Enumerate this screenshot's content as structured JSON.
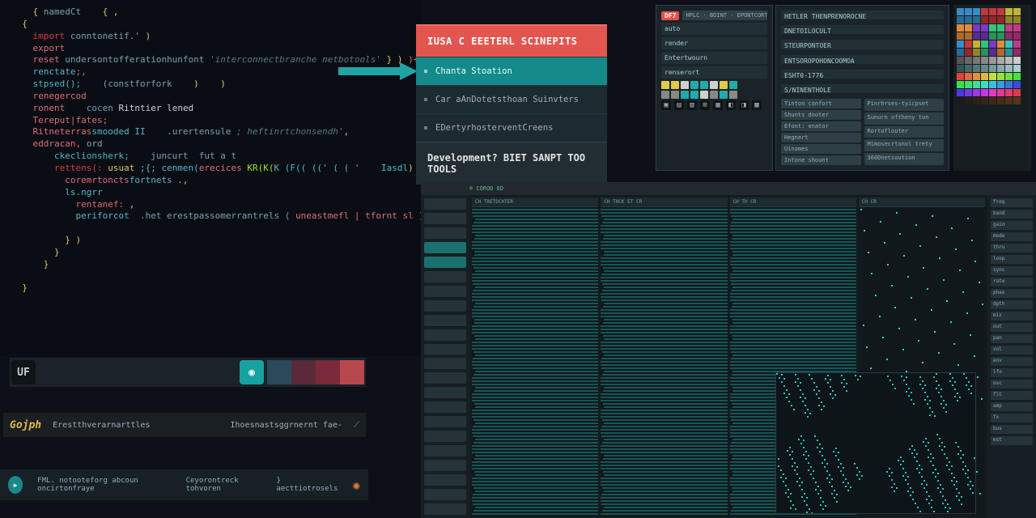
{
  "code": {
    "lines": [
      [
        {
          "c": "tok-punc",
          "t": "    { "
        },
        {
          "c": "tok-var",
          "t": "namedCt"
        },
        {
          "c": "tok-punc",
          "t": "    { ,"
        }
      ],
      [
        {
          "c": "tok-punc",
          "t": "  {"
        }
      ],
      [
        {
          "c": "tok-kw",
          "t": "    import "
        },
        {
          "c": "tok-var",
          "t": "conntonetif.'"
        },
        {
          "c": "tok-punc",
          "t": " )"
        }
      ],
      [
        {
          "c": "tok-type",
          "t": "    export"
        }
      ],
      [
        {
          "c": "tok-type",
          "t": "    reset "
        },
        {
          "c": "tok-var",
          "t": "undersontofferationhunfont"
        },
        {
          "c": "tok-comment",
          "t": " 'interconnectbranche netbotools' "
        },
        {
          "c": "tok-punc",
          "t": "} )"
        },
        {
          "c": "tok-type",
          "t": " )+"
        }
      ],
      [
        {
          "c": "tok-fn",
          "t": "    renctate"
        },
        {
          "c": "tok-type",
          "t": ";,"
        }
      ],
      [
        {
          "c": "tok-prop",
          "t": "    stpsed();"
        },
        {
          "c": "tok-var",
          "t": "    (constforfork"
        },
        {
          "c": "tok-punc",
          "t": "    )    )"
        }
      ],
      [
        {
          "c": "tok-type",
          "t": "    renegercod"
        }
      ],
      [
        {
          "c": "tok-type",
          "t": "    ronent"
        },
        {
          "c": "tok-var",
          "t": "    cocen "
        },
        {
          "c": "",
          "t": "Ritntier lened"
        }
      ],
      [
        {
          "c": "tok-type",
          "t": "    Tereput|fates;"
        }
      ],
      [
        {
          "c": "tok-type",
          "t": "    Ritneterras"
        },
        {
          "c": "tok-fn",
          "t": "smooded II"
        },
        {
          "c": "tok-var",
          "t": "    .urertensule"
        },
        {
          "c": "tok-comment",
          "t": " ; heftinrtchonsendh'"
        },
        {
          "c": "tok-punc",
          "t": ","
        }
      ],
      [
        {
          "c": "tok-type",
          "t": "    eddracan,"
        },
        {
          "c": "tok-var",
          "t": " ord"
        }
      ],
      [
        {
          "c": "tok-prop",
          "t": "        ckeclionsherk;"
        },
        {
          "c": "tok-var",
          "t": "    juncurt  fut a t"
        }
      ],
      [
        {
          "c": "tok-kw",
          "t": "        rettens(:"
        },
        {
          "c": "tok-punc",
          "t": " usuat "
        },
        {
          "c": "tok-fn",
          "t": ";{; cenmen("
        },
        {
          "c": "tok-type",
          "t": "erecices"
        },
        {
          "c": "tok-str",
          "t": " KR(K("
        },
        {
          "c": "tok-fn",
          "t": "K (F(( ((' ( ( '"
        },
        {
          "c": "tok-prop",
          "t": "    Iasdl"
        },
        {
          "c": "tok-punc",
          "t": ")"
        },
        {
          "c": "",
          "t": "                  |"
        }
      ],
      [
        {
          "c": "tok-type",
          "t": "          coremrtoncts"
        },
        {
          "c": "tok-fn",
          "t": "fortnets"
        },
        {
          "c": "tok-punc",
          "t": " .,"
        }
      ],
      [
        {
          "c": "tok-prop",
          "t": "          ls.ngrr"
        }
      ],
      [
        {
          "c": "tok-type",
          "t": "            rentanef:"
        },
        {
          "c": "tok-punc",
          "t": " ,"
        }
      ],
      [
        {
          "c": "tok-fn",
          "t": "            periforcot"
        },
        {
          "c": "tok-var",
          "t": "  .het erestpassomerrantrels ("
        },
        {
          "c": "tok-type",
          "t": " uneastmefl | tfornt sl"
        },
        {
          "c": "tok-punc",
          "t": " )-;!"
        }
      ],
      [],
      [
        {
          "c": "tok-punc",
          "t": "          } )"
        }
      ],
      [
        {
          "c": "tok-punc",
          "t": "        }"
        }
      ],
      [
        {
          "c": "tok-punc",
          "t": "      }"
        }
      ],
      [],
      [
        {
          "c": "tok-punc",
          "t": "  }"
        }
      ]
    ]
  },
  "menu": {
    "header": "IUSA C EEETERL SCINEPITS",
    "items": [
      {
        "label": "Chanta Stoation",
        "active": true
      },
      {
        "label": "Car aAnDotetsthoan Suinvters",
        "active": false
      },
      {
        "label": "EDertyrhosterventCreens",
        "active": false
      }
    ],
    "footer": "Development? BIET SANPT TOO TOOLS"
  },
  "dash_a": {
    "badge": "DF7",
    "rows": [
      "auto",
      "render",
      "Entertwourn",
      "renserort"
    ],
    "cells": [
      [
        "#e2c94a",
        "#e2c94a",
        "#d0d0d0",
        "#2aa",
        "#2aa",
        "#d0d0d0",
        "#e2c94a",
        "#2aa"
      ],
      [
        "#888",
        "#888",
        "#2aa",
        "#2aa",
        "#d0d0d0",
        "#888",
        "#2aa",
        "#888"
      ]
    ],
    "icons": [
      "▣",
      "▤",
      "▥",
      "⊞",
      "▦",
      "◧",
      "◨",
      "▩"
    ]
  },
  "dash_b": {
    "labels": [
      "HETLER THENPRENOROCNE",
      "DNETOILOCULT",
      "STEURPONTOER",
      "ENTSOROPOHONCOOMOA",
      "ESHT0-1776",
      "S/NINENTHOLE"
    ],
    "lists": [
      [
        "Tinton confort",
        "Shunts dooter",
        "Efont: enator",
        "Hegnert",
        "Uinomes",
        "Intone shount"
      ],
      [
        "Pinrhrses-tyicpset",
        "Sunurn oftheny ton",
        "Rortoflouter",
        "Mimosecrtonol trety",
        "360Dnetsoution"
      ]
    ]
  },
  "swatches": [
    [
      "#3a8ac4",
      "#3a8ac4",
      "#3a8ac4",
      "#c13939",
      "#c13939",
      "#c13939",
      "#c1b339",
      "#c1b339"
    ],
    [
      "#2a6a94",
      "#2a6a94",
      "#2a6a94",
      "#912929",
      "#912929",
      "#912929",
      "#918329",
      "#918329"
    ],
    [
      "#e08a3a",
      "#e08a3a",
      "#7a3ac1",
      "#7a3ac1",
      "#3ac17a",
      "#3ac17a",
      "#c13a8a",
      "#c13a8a"
    ],
    [
      "#b06a2a",
      "#b06a2a",
      "#5a2a91",
      "#5a2a91",
      "#2a915a",
      "#2a915a",
      "#912a6a",
      "#912a6a"
    ],
    [
      "#3a8ac4",
      "#c13939",
      "#c1b339",
      "#3ac17a",
      "#7a3ac1",
      "#e08a3a",
      "#3ac1c1",
      "#c13a8a"
    ],
    [
      "#2a6a94",
      "#912929",
      "#918329",
      "#2a915a",
      "#5a2a91",
      "#b06a2a",
      "#2a9191",
      "#912a6a"
    ],
    [
      "#555",
      "#666",
      "#777",
      "#888",
      "#999",
      "#aaa",
      "#bbb",
      "#ccc"
    ],
    [
      "#355",
      "#466",
      "#577",
      "#688",
      "#799",
      "#8aa",
      "#9bb",
      "#acc"
    ],
    [
      "#e0433a",
      "#e06a3a",
      "#e0913a",
      "#e0b83a",
      "#c1e03a",
      "#9ae03a",
      "#73e03a",
      "#4ce03a"
    ],
    [
      "#3ae04c",
      "#3ae073",
      "#3ae09a",
      "#3ae0c1",
      "#3ac1e0",
      "#3a9ae0",
      "#3a73e0",
      "#3a4ce0"
    ],
    [
      "#4c3ae0",
      "#733ae0",
      "#9a3ae0",
      "#c13ae0",
      "#e03ac1",
      "#e03a9a",
      "#e03a73",
      "#e03a4c"
    ],
    [
      "#201818",
      "#281c18",
      "#302018",
      "#382418",
      "#402818",
      "#482c18",
      "#503018",
      "#583418"
    ]
  ],
  "toolbar": {
    "btn1": "UF",
    "swatches": [
      "#2a4a5a",
      "#5a2a3a",
      "#7a2a3a",
      "#b8484f"
    ]
  },
  "glyph": {
    "logo": "Gojph",
    "left": "Erestthverarnarttles",
    "right": "Ihoesnastsggrnernt fae-"
  },
  "status": {
    "left": "FML.  notooteforg abcoun oncirtonfraye",
    "mid": "Ceyorontreck tohvoren",
    "right": "} aecttiotrosels"
  },
  "viewer": {
    "top": "® COROD ED",
    "headers": [
      "CH TRETOCHTER",
      "CH THCK ET CR",
      "CH TH CR",
      "CH CR"
    ],
    "side_count": 22,
    "side_hl": [
      3,
      4
    ],
    "right_labels": [
      "freq",
      "band",
      "gain",
      "mode",
      "thru",
      "loop",
      "sync",
      "rate",
      "phas",
      "dpth",
      "mix",
      "out",
      "pan",
      "vol",
      "env",
      "lfo",
      "osc",
      "flt",
      "amp",
      "fx",
      "bus",
      "mst"
    ]
  }
}
